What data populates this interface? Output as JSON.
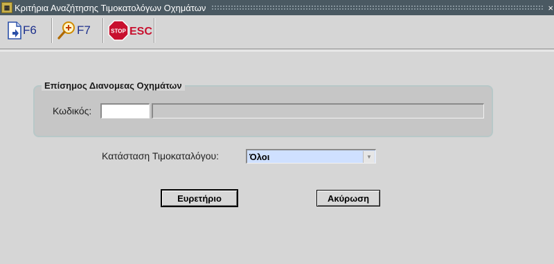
{
  "window": {
    "title": "Κριτήρια Αναζήτησης Τιμοκατολόγων Οχημάτων",
    "close_glyph": "×"
  },
  "toolbar": {
    "f6_label": "F6",
    "f7_label": "F7",
    "esc_label": "ESC",
    "stop_label": "STOP"
  },
  "group": {
    "title": "Επίσημος Διανομεας Οχημάτων",
    "code_label": "Κωδικός:",
    "code_value": "",
    "description_value": ""
  },
  "status": {
    "label": "Κατάσταση Τιμοκαταλόγου:",
    "selected": "Όλοι"
  },
  "buttons": {
    "index_label": "Ευρετήριο",
    "cancel_label": "Ακύρωση"
  },
  "colors": {
    "titlebar": "#4a5962",
    "background": "#d6d6d6",
    "select_highlight": "#cfe0ff",
    "toolbar_text": "#1c2f8c",
    "stop_red": "#c8102e"
  }
}
